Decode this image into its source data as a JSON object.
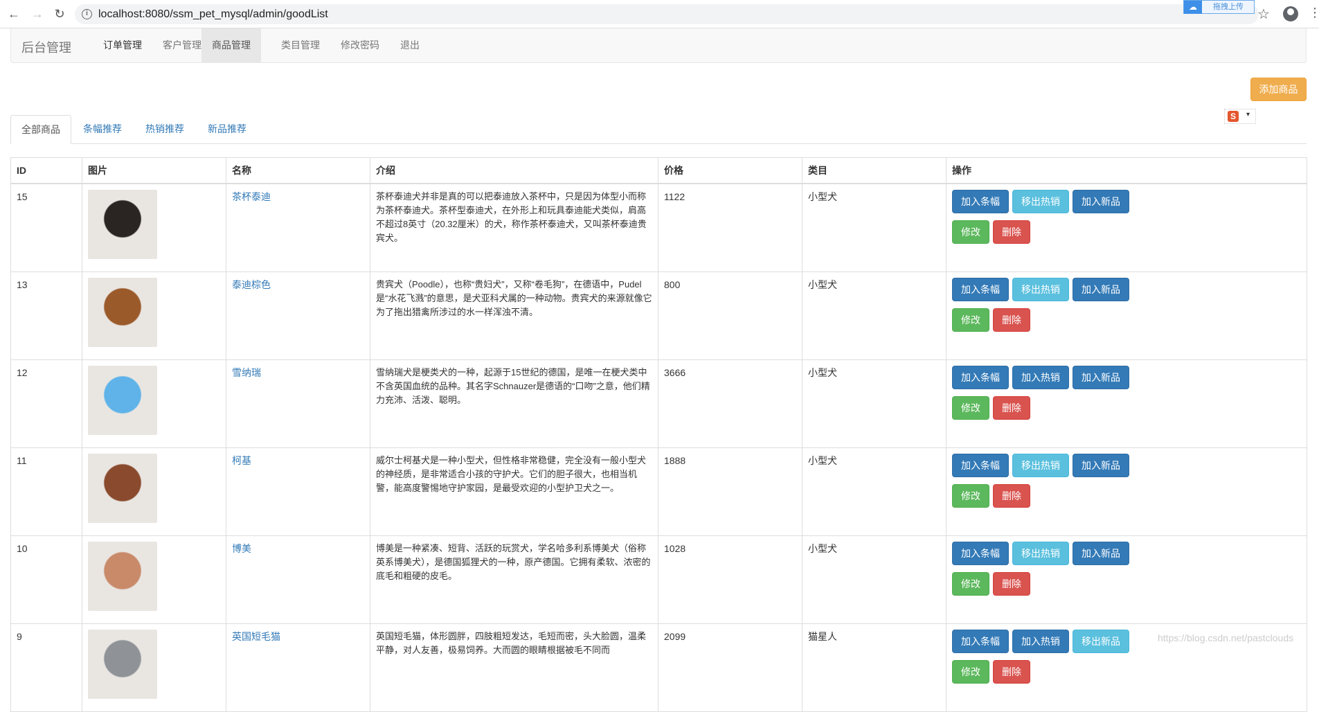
{
  "browser": {
    "url": "localhost:8080/ssm_pet_mysql/admin/goodList",
    "upload_label": "拖拽上传"
  },
  "navbar": {
    "brand": "后台管理",
    "items": [
      {
        "label": "订单管理"
      },
      {
        "label": "客户管理"
      },
      {
        "label": "商品管理"
      },
      {
        "label": "类目管理"
      },
      {
        "label": "修改密码"
      },
      {
        "label": "退出"
      }
    ]
  },
  "add_button": "添加商品",
  "tabs": [
    {
      "label": "全部商品"
    },
    {
      "label": "条幅推荐"
    },
    {
      "label": "热销推荐"
    },
    {
      "label": "新品推荐"
    }
  ],
  "table": {
    "headers": [
      "ID",
      "图片",
      "名称",
      "介绍",
      "价格",
      "类目",
      "操作"
    ],
    "rows": [
      {
        "id": "15",
        "name": "茶杯泰迪",
        "intro": "茶杯泰迪犬并非是真的可以把泰迪放入茶杯中，只是因为体型小而称为茶杯泰迪犬。茶杯型泰迪犬，在外形上和玩具泰迪能犬类似，肩高不超过8英寸（20.32厘米）的犬，称作茶杯泰迪犬，又叫茶杯泰迪贵宾犬。",
        "price": "1122",
        "category": "小型犬",
        "btn1": "加入条幅",
        "btn2": "移出热销",
        "btn3": "加入新品",
        "edit": "修改",
        "del": "删除",
        "photo_color": "#2a2522"
      },
      {
        "id": "13",
        "name": "泰迪棕色",
        "intro": "贵宾犬（Poodle），也称“贵妇犬”，又称“卷毛狗”，在德语中，Pudel是“水花飞溅”的意思，是犬亚科犬属的一种动物。贵宾犬的来源就像它为了拖出猎禽所涉过的水一样浑浊不清。",
        "price": "800",
        "category": "小型犬",
        "btn1": "加入条幅",
        "btn2": "移出热销",
        "btn3": "加入新品",
        "edit": "修改",
        "del": "删除",
        "photo_color": "#9b5a2a"
      },
      {
        "id": "12",
        "name": "雪纳瑞",
        "intro": "雪纳瑞犬是梗类犬的一种，起源于15世纪的德国，是唯一在梗犬类中不含英国血统的品种。其名字Schnauzer是德语的“口吻”之意，他们精力充沛、活泼、聪明。",
        "price": "3666",
        "category": "小型犬",
        "btn1": "加入条幅",
        "btn2": "加入热销",
        "btn3": "加入新品",
        "edit": "修改",
        "del": "删除",
        "photo_color": "#5fb3e8"
      },
      {
        "id": "11",
        "name": "柯基",
        "intro": "威尔士柯基犬是一种小型犬，但性格非常稳健，完全没有一般小型犬的神经质，是非常适合小孩的守护犬。它们的胆子很大，也相当机警，能高度警惕地守护家园，是最受欢迎的小型护卫犬之一。",
        "price": "1888",
        "category": "小型犬",
        "btn1": "加入条幅",
        "btn2": "移出热销",
        "btn3": "加入新品",
        "edit": "修改",
        "del": "删除",
        "photo_color": "#8a4a2e"
      },
      {
        "id": "10",
        "name": "博美",
        "intro": "博美是一种紧凑、短背、活跃的玩赏犬，学名哈多利系博美犬（俗称英系博美犬），是德国狐狸犬的一种，原产德国。它拥有柔软、浓密的底毛和粗硬的皮毛。",
        "price": "1028",
        "category": "小型犬",
        "btn1": "加入条幅",
        "btn2": "移出热销",
        "btn3": "加入新品",
        "edit": "修改",
        "del": "删除",
        "photo_color": "#c98a6a"
      },
      {
        "id": "9",
        "name": "英国短毛猫",
        "intro": "英国短毛猫，体形圆胖，四肢粗短发达，毛短而密，头大脸圆，温柔平静，对人友善，极易饲养。大而圆的眼睛根据被毛不同而",
        "price": "2099",
        "category": "猫星人",
        "btn1": "加入条幅",
        "btn2": "加入热销",
        "btn3": "移出新品",
        "edit": "修改",
        "del": "删除",
        "photo_color": "#8f9398"
      }
    ]
  },
  "watermark": "https://blog.csdn.net/pastclouds"
}
